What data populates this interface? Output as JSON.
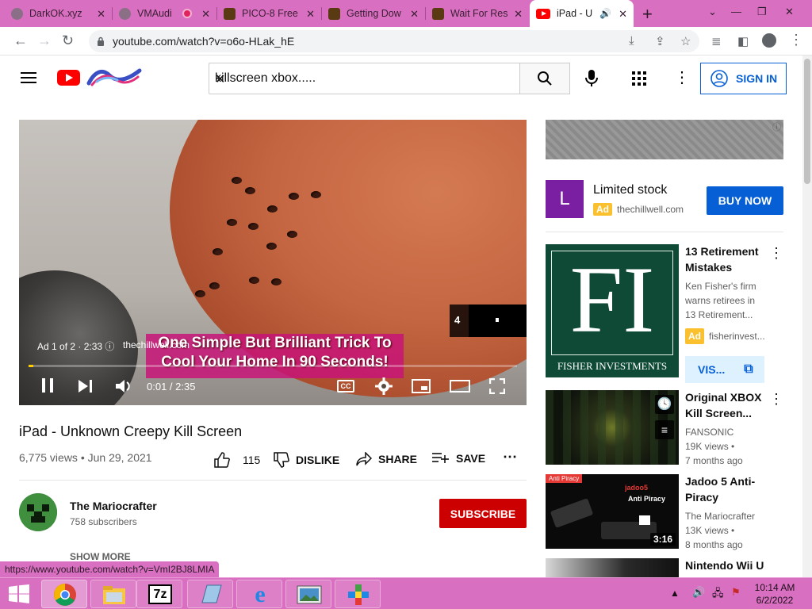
{
  "browser": {
    "tabs": [
      {
        "title": "DarkOK.xyz",
        "favicon": "globe-icon",
        "active": false
      },
      {
        "title": "VMAudi",
        "favicon": "globe-icon",
        "active": false
      },
      {
        "title": "PICO-8 Free",
        "favicon": "g-icon",
        "active": false
      },
      {
        "title": "Getting Dow",
        "favicon": "g-icon",
        "active": false
      },
      {
        "title": "Wait For Res",
        "favicon": "g-icon",
        "active": false
      },
      {
        "title": "iPad - U",
        "favicon": "youtube-icon",
        "active": true
      }
    ],
    "url": "youtube.com/watch?v=o6o-HLak_hE",
    "status_url": "https://www.youtube.com/watch?v=VmI2BJ8LMIA"
  },
  "youtube": {
    "search_query": "killscreen xbox.....",
    "sign_in": "SIGN IN"
  },
  "player": {
    "ad_label": "Ad 1 of 2 · 2:33",
    "ad_site": "thechillwell.com",
    "ad_text_line1": "One Simple But Brilliant Trick To",
    "ad_text_line2": "Cool Your Home In 90 Seconds!",
    "skip_countdown": "4",
    "time": "0:01 / 2:35",
    "progress": 0.01
  },
  "video": {
    "title": "iPad - Unknown Creepy Kill Screen",
    "meta": "6,775 views • Jun 29, 2021",
    "likes": "115",
    "dislike": "DISLIKE",
    "share": "SHARE",
    "save": "SAVE",
    "channel": "The Mariocrafter",
    "subscribers": "758 subscribers",
    "subscribe": "SUBSCRIBE",
    "show_more": "SHOW MORE"
  },
  "sidebar": {
    "ad": {
      "letter": "L",
      "title": "Limited stock",
      "badge": "Ad",
      "site": "thechillwell.com",
      "button": "BUY NOW"
    },
    "items": [
      {
        "title": "13 Retirement Mistakes",
        "line1": "Ken Fisher's firm",
        "line2": "warns retirees in",
        "line3": "13 Retirement...",
        "badge": "Ad",
        "site": "fisherinvest...",
        "button": "VIS...",
        "thumb_text": "FI",
        "thumb_caption": "FISHER INVESTMENTS"
      },
      {
        "title": "Original XBOX Kill Screen...",
        "channel": "FANSONIC",
        "views": "19K views •",
        "age": "7 months ago"
      },
      {
        "title": "Jadoo 5 Anti-Piracy",
        "channel": "The Mariocrafter",
        "views": "13K views •",
        "age": "8 months ago",
        "duration": "3:16",
        "thumb_tag": "Anti Piracy",
        "thumb_brand": "jadoo5",
        "thumb_sub": "Anti Piracy"
      },
      {
        "title": "Nintendo Wii U"
      }
    ]
  },
  "taskbar": {
    "time": "10:14 AM",
    "date": "6/2/2022",
    "seven_zip": "7z"
  }
}
